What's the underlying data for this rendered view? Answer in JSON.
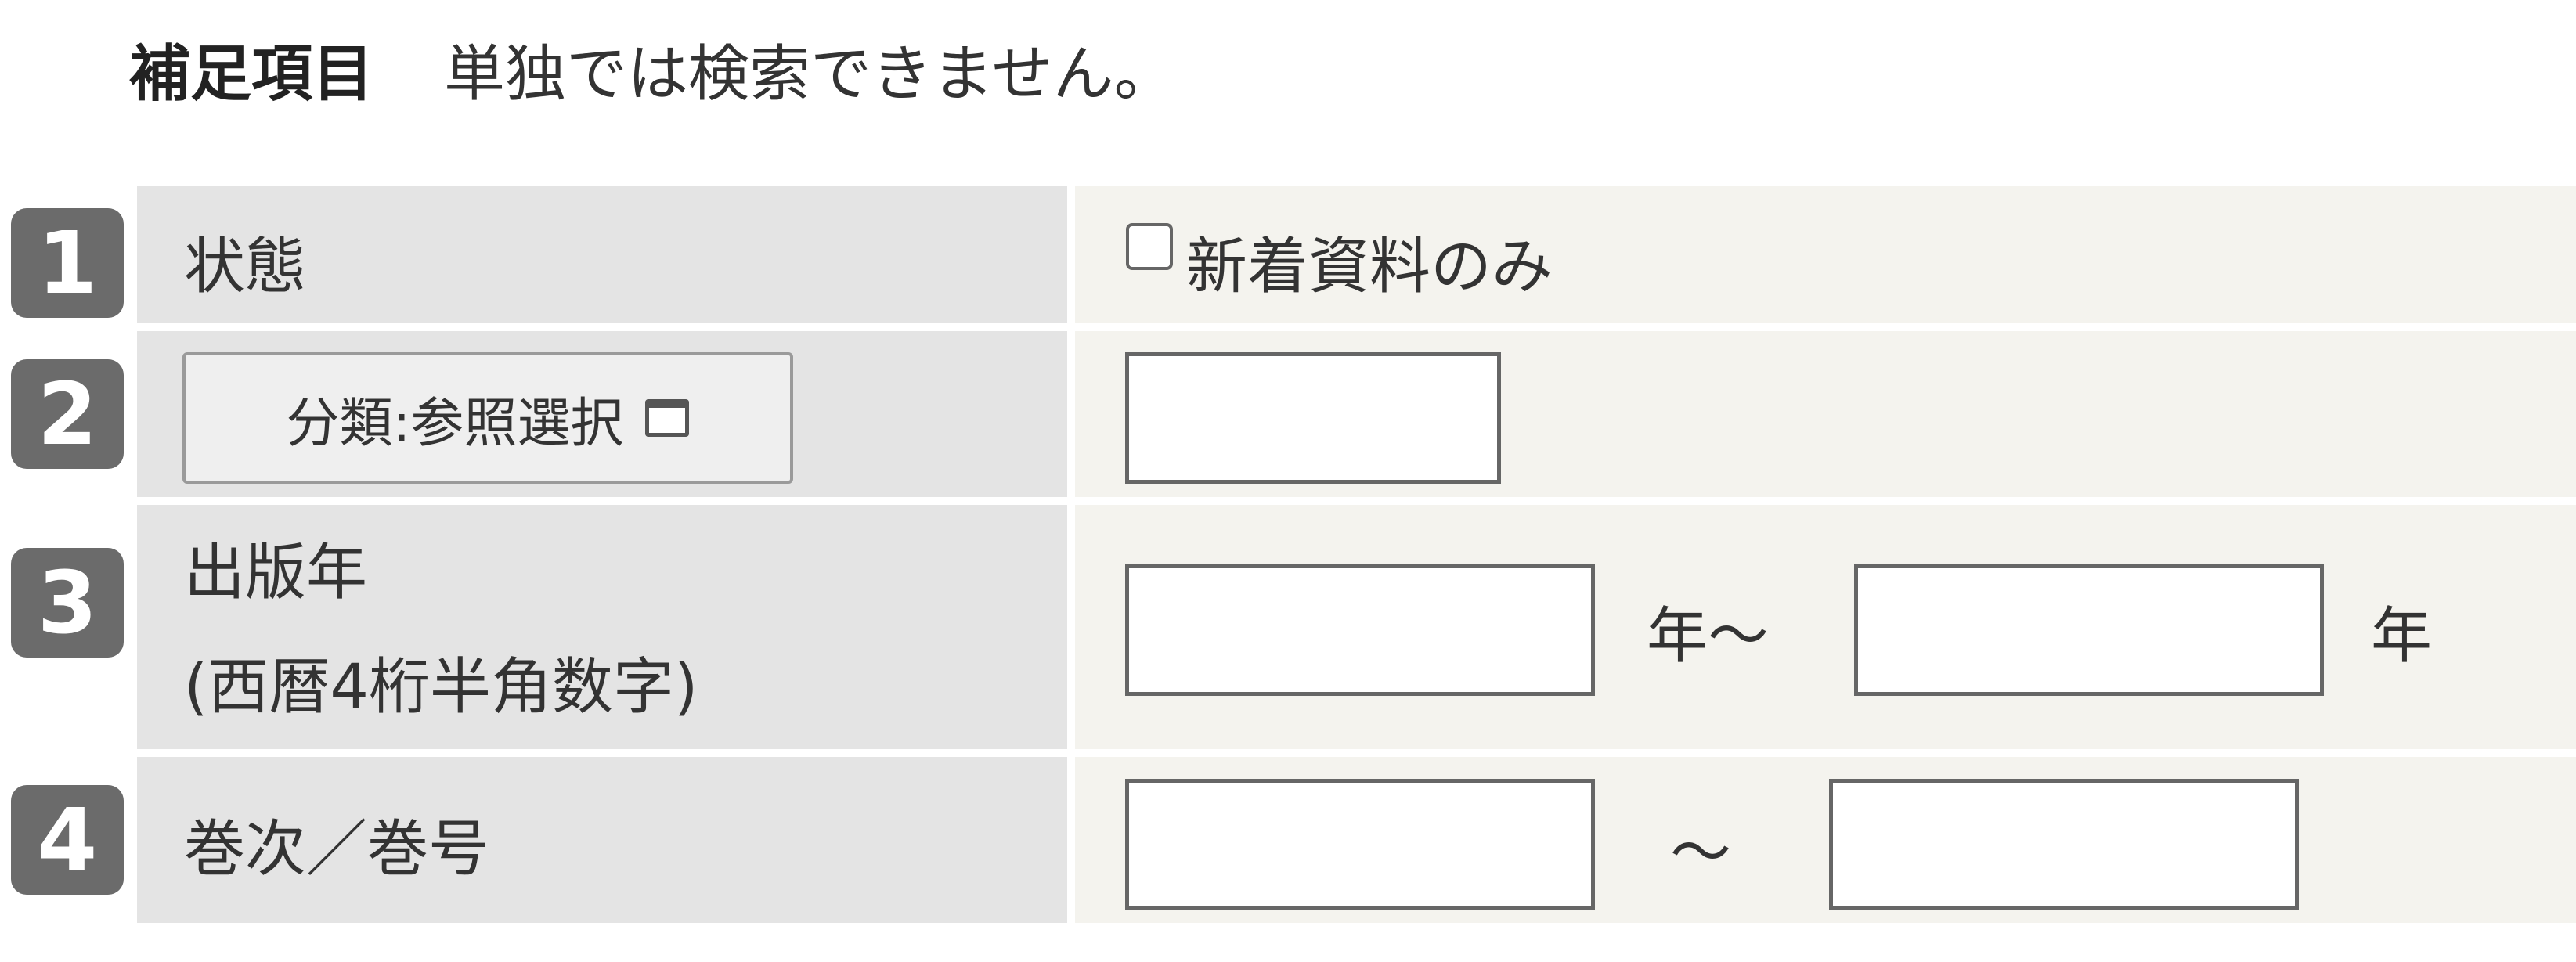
{
  "header": {
    "title": "補足項目",
    "note": "単独では検索できません。"
  },
  "rows": [
    {
      "number": "1",
      "label": "状態",
      "checkbox_label": "新着資料のみ",
      "checked": false
    },
    {
      "number": "2",
      "button_label": "分類:参照選択",
      "button_icon": "window-icon",
      "value": ""
    },
    {
      "number": "3",
      "label_line1": "出版年",
      "label_line2": "(西暦4桁半角数字)",
      "from_value": "",
      "to_value": "",
      "unit_from": "年～",
      "unit_to": "年"
    },
    {
      "number": "4",
      "label": "巻次／巻号",
      "from_value": "",
      "to_value": "",
      "separator": "～"
    }
  ]
}
